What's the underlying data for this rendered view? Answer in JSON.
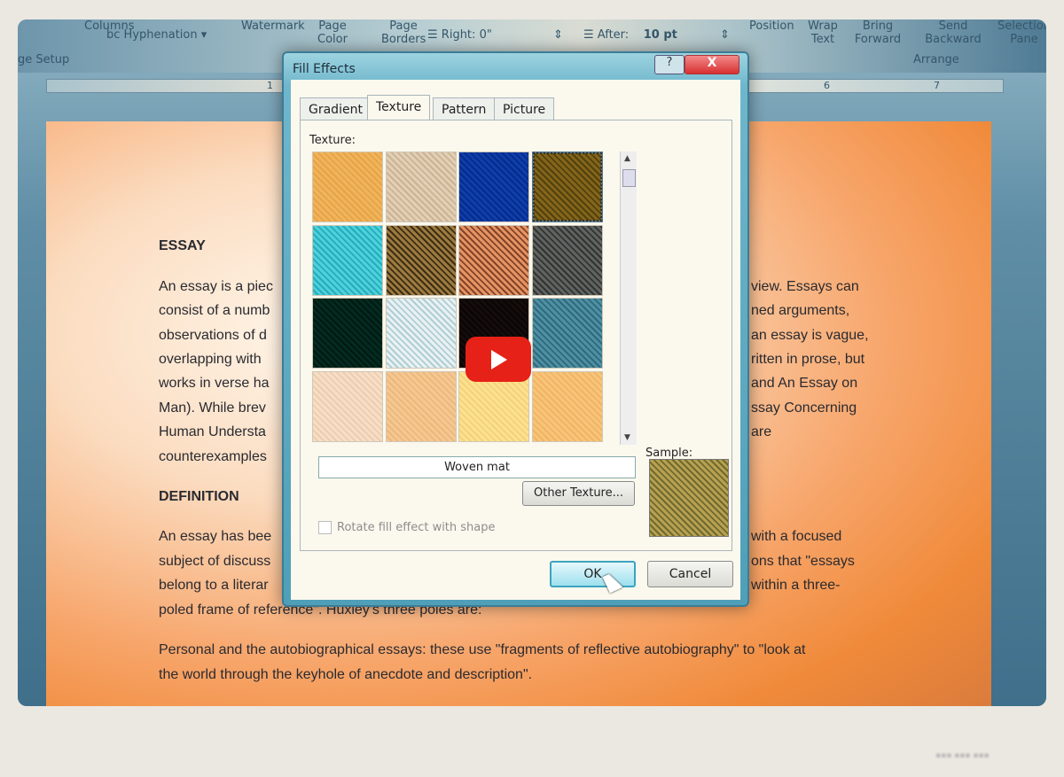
{
  "ribbon": {
    "columns": "Columns",
    "hyphenation": "Hyphenation",
    "page_setup": "ge Setup",
    "watermark": "Watermark",
    "page_color": "Page Color",
    "page_borders": "Page Borders",
    "right_label": "Right:",
    "right_value": "0\"",
    "after_label": "After:",
    "after_value": "10 pt",
    "position": "Position",
    "wrap_text": "Wrap Text",
    "bring_forward": "Bring Forward",
    "send_backward": "Send Backward",
    "selection_pane": "Selection Pane",
    "arrange": "Arrange"
  },
  "ruler": [
    "1",
    "6",
    "7"
  ],
  "document": {
    "heading1": "ESSAY",
    "para1": [
      [
        "An essay is a piec",
        "view. Essays can"
      ],
      [
        "consist of a numb",
        "ned arguments,"
      ],
      [
        "observations of d",
        "an essay is vague,"
      ],
      [
        "overlapping with",
        "ritten in prose, but"
      ],
      [
        "works in verse ha",
        "and An Essay on"
      ],
      [
        "Man). While brev",
        "ssay Concerning"
      ],
      [
        "Human Understa",
        "are"
      ],
      [
        "counterexamples",
        ""
      ]
    ],
    "heading2": "DEFINITION",
    "para2": [
      [
        "An essay has bee",
        "with a focused"
      ],
      [
        "subject of discuss",
        "ons that \"essays"
      ],
      [
        "belong to a literar",
        "within a three-"
      ],
      [
        "poled frame of reference\". Huxley's three poles are:",
        ""
      ]
    ],
    "para3": [
      "Personal and the autobiographical essays: these use \"fragments of reflective autobiography\" to \"look at",
      "the world through the keyhole of anecdote and description\"."
    ]
  },
  "dialog": {
    "title": "Fill Effects",
    "help": "?",
    "close": "X",
    "tabs": [
      {
        "label": "Gradient",
        "active": false
      },
      {
        "label": "Texture",
        "active": true
      },
      {
        "label": "Pattern",
        "active": false
      },
      {
        "label": "Picture",
        "active": false
      }
    ],
    "texture_label": "Texture:",
    "textures": [
      {
        "name": "papyrus",
        "colors": [
          "#f7d79a",
          "#f0c070"
        ]
      },
      {
        "name": "canvas",
        "colors": [
          "#f0e6d6",
          "#d8c6b2"
        ]
      },
      {
        "name": "denim",
        "colors": [
          "#3b7fd0",
          "#1f55a8"
        ]
      },
      {
        "name": "woven-mat",
        "colors": [
          "#b8a050",
          "#6e6a30"
        ],
        "selected": true
      },
      {
        "name": "water-droplets",
        "colors": [
          "#8fe6ec",
          "#3cc0cc"
        ]
      },
      {
        "name": "paper-bag",
        "colors": [
          "#c8b080",
          "#4d4226"
        ]
      },
      {
        "name": "fish-fossil",
        "colors": [
          "#f2c2a0",
          "#8a5a40"
        ]
      },
      {
        "name": "sand",
        "colors": [
          "#9aa0a0",
          "#5a5048"
        ]
      },
      {
        "name": "green-marble",
        "colors": [
          "#1d6a5a",
          "#0a3a30"
        ]
      },
      {
        "name": "white-marble",
        "colors": [
          "#f4f8f8",
          "#b6d4dc"
        ]
      },
      {
        "name": "brown-marble",
        "colors": [
          "#4a3a34",
          "#1a1818"
        ]
      },
      {
        "name": "granite",
        "colors": [
          "#8cc0cc",
          "#5a8a9a"
        ]
      },
      {
        "name": "newsprint",
        "colors": [
          "#fbeee0",
          "#efdccc"
        ]
      },
      {
        "name": "recycled-paper",
        "colors": [
          "#fae2c0",
          "#f0d0a8"
        ]
      },
      {
        "name": "parchment",
        "colors": [
          "#fdf0c0",
          "#f7dea0"
        ]
      },
      {
        "name": "stationery",
        "colors": [
          "#fbe0b0",
          "#f5cc90"
        ]
      }
    ],
    "texture_name": "Woven mat",
    "other_texture": "Other Texture...",
    "sample_label": "Sample:",
    "rotate_label": "Rotate fill effect with shape",
    "rotate_checked": false,
    "ok": "OK",
    "cancel": "Cancel"
  },
  "video": {
    "play_icon": "youtube-play-icon"
  }
}
